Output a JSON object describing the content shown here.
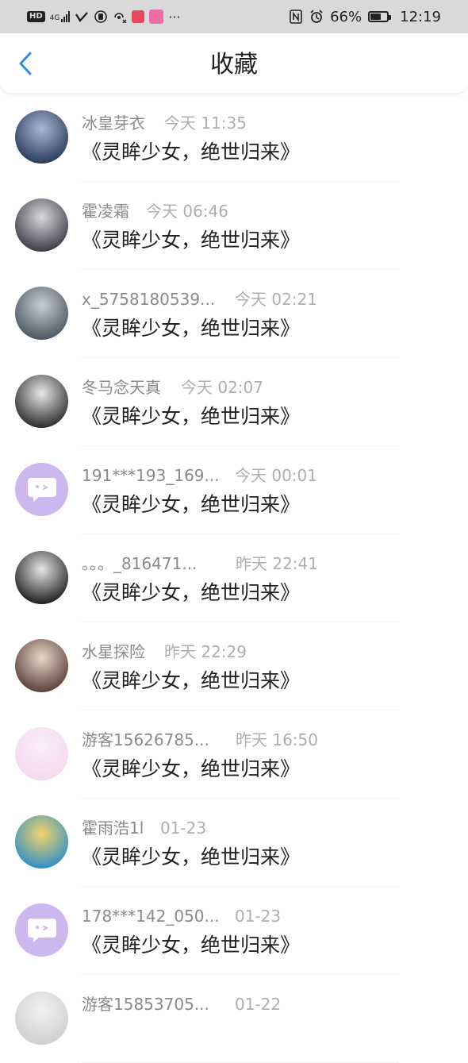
{
  "status_bar": {
    "hd": "HD",
    "network": "4G",
    "battery_percent_text": "66%",
    "battery_level": 0.66,
    "time": "12:19",
    "more": "···",
    "icons": [
      "hd-icon",
      "signal-icon",
      "wifi-calling-icon",
      "hand-icon",
      "hotspot-icon",
      "app-notification-icon",
      "app-notification-icon",
      "nfc-icon",
      "alarm-icon",
      "battery-icon"
    ]
  },
  "header": {
    "back_icon": "chevron-left-icon",
    "title": "收藏",
    "accent": "#2f8ff0"
  },
  "favorites": [
    {
      "user": "冰皇芽衣",
      "time": "今天 11:35",
      "title": "《灵眸少女，绝世归来》",
      "avatar": "photo",
      "avatar_colors": [
        "#2a3a5c",
        "#a9b8d6"
      ]
    },
    {
      "user": "霍凌霜",
      "time": "今天 06:46",
      "title": "《灵眸少女，绝世归来》",
      "avatar": "photo",
      "avatar_colors": [
        "#3b3b44",
        "#d9d9de"
      ]
    },
    {
      "user": "x_5758180539...",
      "time": "今天 02:21",
      "title": "《灵眸少女，绝世归来》",
      "avatar": "photo",
      "avatar_colors": [
        "#4a5560",
        "#c8ced6"
      ]
    },
    {
      "user": "冬马念天真",
      "time": "今天 02:07",
      "title": "《灵眸少女，绝世归来》",
      "avatar": "photo",
      "avatar_colors": [
        "#2b2b2b",
        "#e8e8e8"
      ]
    },
    {
      "user": "191***193_169...",
      "time": "今天 00:01",
      "title": "《灵眸少女，绝世归来》",
      "avatar": "default",
      "avatar_colors": [
        "#cdb7ef",
        "#ffffff"
      ]
    },
    {
      "user": "。。。_816471...",
      "time": "昨天 22:41",
      "title": "《灵眸少女，绝世归来》",
      "avatar": "photo",
      "avatar_colors": [
        "#1e1e1e",
        "#e6e6e6"
      ]
    },
    {
      "user": "水星探险",
      "time": "昨天 22:29",
      "title": "《灵眸少女，绝世归来》",
      "avatar": "photo",
      "avatar_colors": [
        "#5a4038",
        "#e8d6c8"
      ]
    },
    {
      "user": "游客15626785...",
      "time": "昨天 16:50",
      "title": "《灵眸少女，绝世归来》",
      "avatar": "photo",
      "avatar_colors": [
        "#f4d9ee",
        "#fbeef7"
      ]
    },
    {
      "user": "霍雨浩1l",
      "time": "01-23",
      "title": "《灵眸少女，绝世归来》",
      "avatar": "photo",
      "avatar_colors": [
        "#2f8fc8",
        "#f4d46a"
      ]
    },
    {
      "user": "178***142_050...",
      "time": "01-23",
      "title": "《灵眸少女，绝世归来》",
      "avatar": "default",
      "avatar_colors": [
        "#cdb7ef",
        "#ffffff"
      ]
    },
    {
      "user": "游客15853705...",
      "time": "01-22",
      "title": "",
      "avatar": "photo",
      "avatar_colors": [
        "#cfcfcf",
        "#f2f2f2"
      ]
    }
  ]
}
